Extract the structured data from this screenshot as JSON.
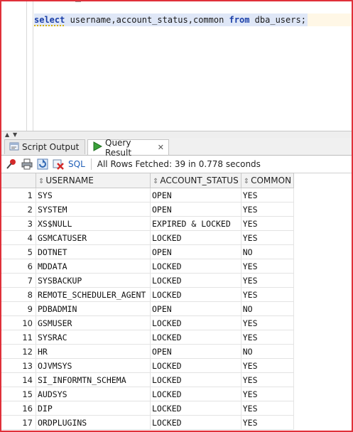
{
  "editor": {
    "sql": {
      "kw1": "select",
      "cols": " username,account_status,common ",
      "kw2": "from",
      "table": " dba_users;"
    }
  },
  "tabs": [
    {
      "label": "Script Output",
      "icon": "script-output-icon",
      "active": false
    },
    {
      "label": "Query Result",
      "icon": "run-play-icon",
      "active": true
    }
  ],
  "toolbar": {
    "sql_label": "SQL",
    "status": "All Rows Fetched: 39 in 0.778 seconds"
  },
  "grid": {
    "columns": [
      "USERNAME",
      "ACCOUNT_STATUS",
      "COMMON"
    ],
    "rows": [
      {
        "n": "1",
        "username": "SYS",
        "status": "OPEN",
        "common": "YES"
      },
      {
        "n": "2",
        "username": "SYSTEM",
        "status": "OPEN",
        "common": "YES"
      },
      {
        "n": "3",
        "username": "XS$NULL",
        "status": "EXPIRED & LOCKED",
        "common": "YES"
      },
      {
        "n": "4",
        "username": "GSMCATUSER",
        "status": "LOCKED",
        "common": "YES"
      },
      {
        "n": "5",
        "username": "DOTNET",
        "status": "OPEN",
        "common": "NO"
      },
      {
        "n": "6",
        "username": "MDDATA",
        "status": "LOCKED",
        "common": "YES"
      },
      {
        "n": "7",
        "username": "SYSBACKUP",
        "status": "LOCKED",
        "common": "YES"
      },
      {
        "n": "8",
        "username": "REMOTE_SCHEDULER_AGENT",
        "status": "LOCKED",
        "common": "YES"
      },
      {
        "n": "9",
        "username": "PDBADMIN",
        "status": "OPEN",
        "common": "NO"
      },
      {
        "n": "10",
        "username": "GSMUSER",
        "status": "LOCKED",
        "common": "YES"
      },
      {
        "n": "11",
        "username": "SYSRAC",
        "status": "LOCKED",
        "common": "YES"
      },
      {
        "n": "12",
        "username": "HR",
        "status": "OPEN",
        "common": "NO"
      },
      {
        "n": "13",
        "username": "OJVMSYS",
        "status": "LOCKED",
        "common": "YES"
      },
      {
        "n": "14",
        "username": "SI_INFORMTN_SCHEMA",
        "status": "LOCKED",
        "common": "YES"
      },
      {
        "n": "15",
        "username": "AUDSYS",
        "status": "LOCKED",
        "common": "YES"
      },
      {
        "n": "16",
        "username": "DIP",
        "status": "LOCKED",
        "common": "YES"
      },
      {
        "n": "17",
        "username": "ORDPLUGINS",
        "status": "LOCKED",
        "common": "YES"
      }
    ]
  }
}
